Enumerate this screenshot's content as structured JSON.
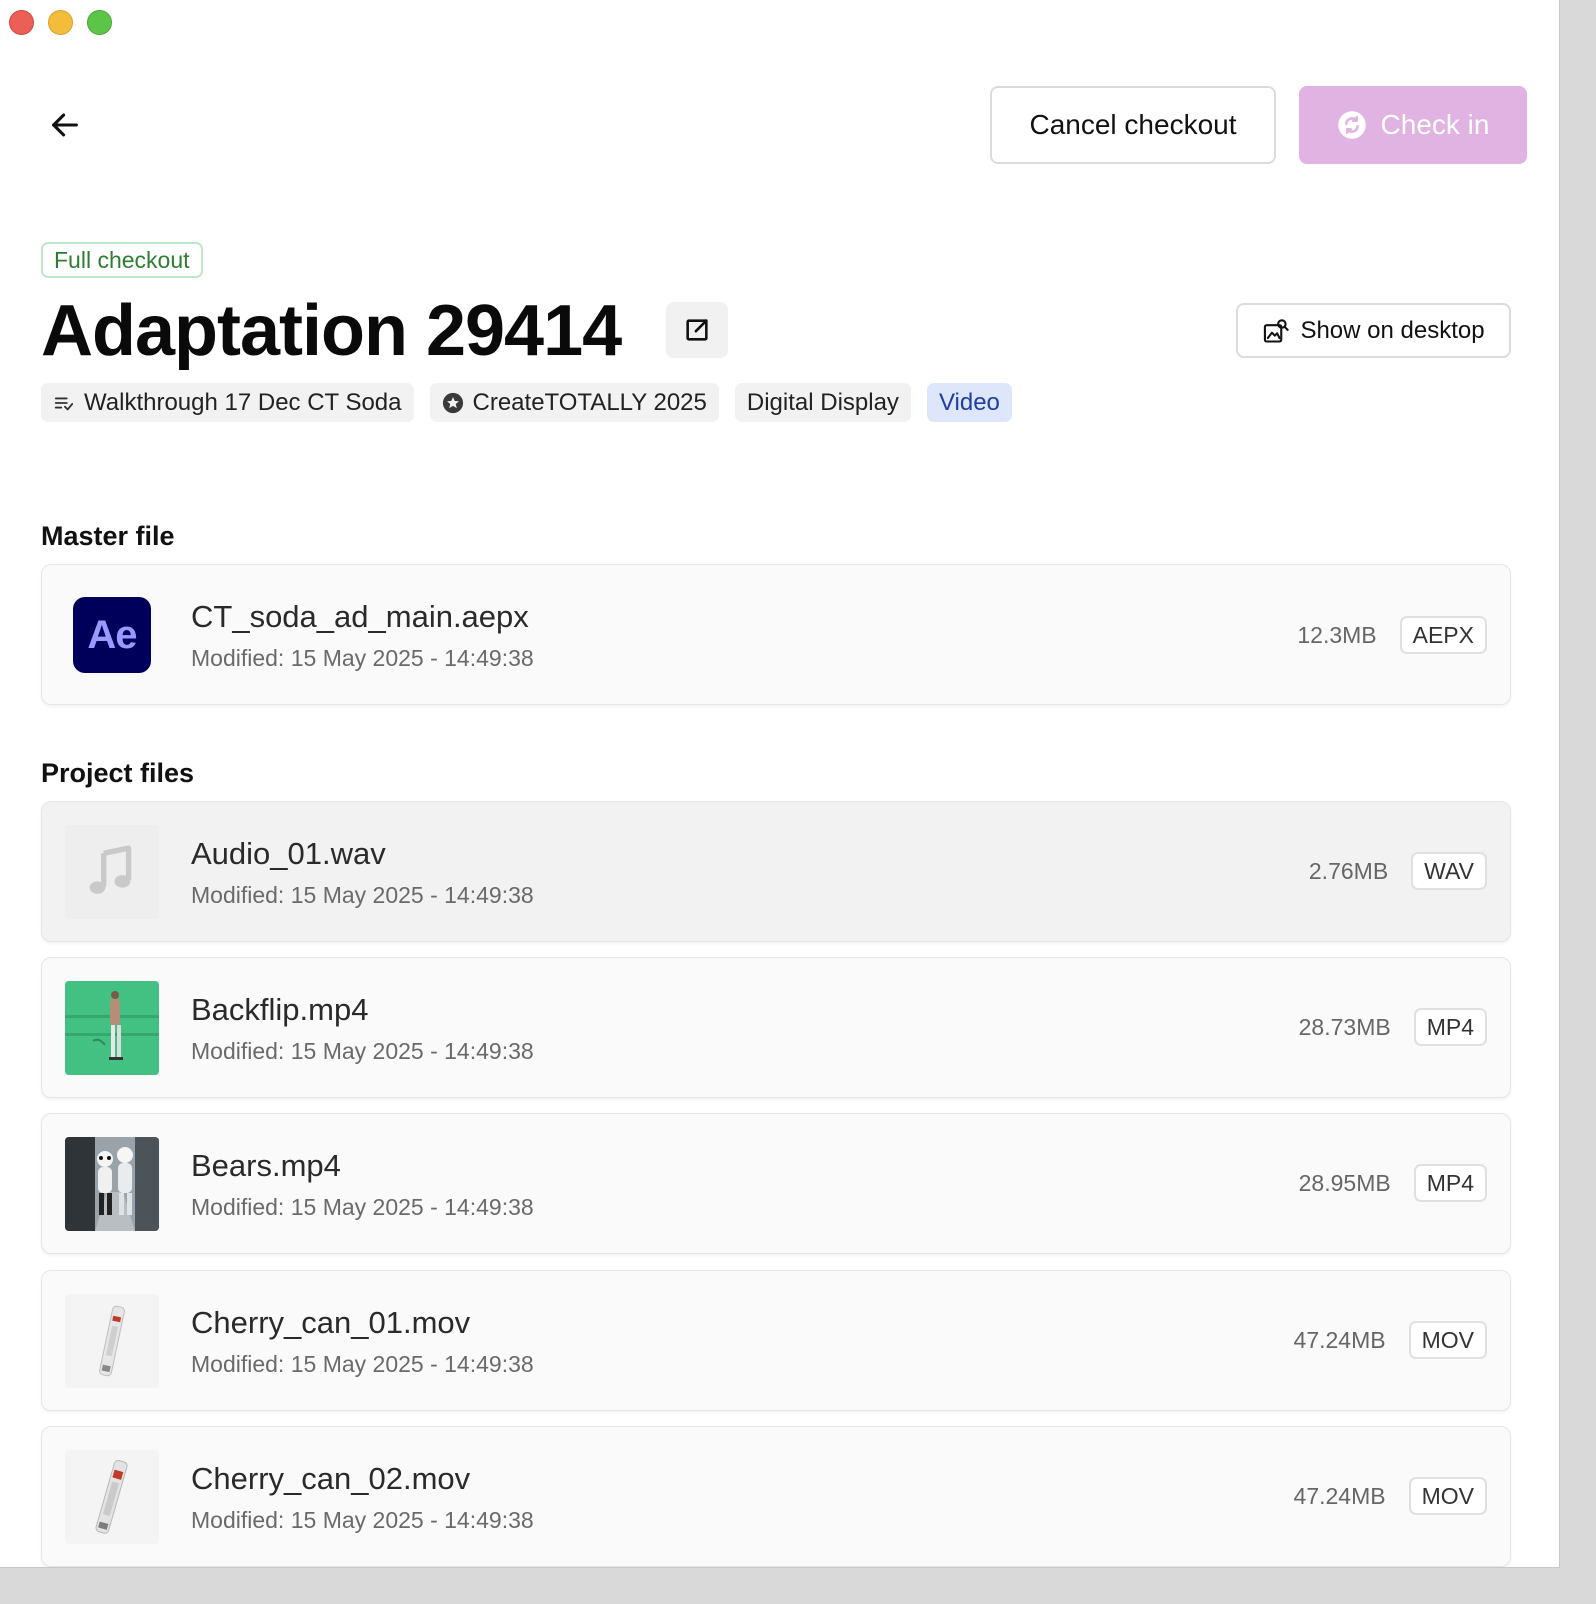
{
  "header": {
    "cancel_label": "Cancel checkout",
    "checkin_label": "Check in"
  },
  "adaptation": {
    "badge": "Full checkout",
    "title": "Adaptation 29414",
    "show_desktop_label": "Show on desktop",
    "tags": [
      {
        "label": "Walkthrough 17 Dec CT Soda",
        "icon": "list-check-icon"
      },
      {
        "label": "CreateTOTALLY 2025",
        "icon": "star-badge-icon"
      },
      {
        "label": "Digital Display",
        "icon": ""
      },
      {
        "label": "Video",
        "icon": ""
      }
    ]
  },
  "master": {
    "section_title": "Master file",
    "file": {
      "name": "CT_soda_ad_main.aepx",
      "modified": "Modified: 15 May 2025 - 14:49:38",
      "size": "12.3MB",
      "type": "AEPX",
      "icon_text": "Ae"
    }
  },
  "project": {
    "section_title": "Project files",
    "files": [
      {
        "name": "Audio_01.wav",
        "modified": "Modified: 15 May 2025 - 14:49:38",
        "size": "2.76MB",
        "type": "WAV"
      },
      {
        "name": "Backflip.mp4",
        "modified": "Modified: 15 May 2025 - 14:49:38",
        "size": "28.73MB",
        "type": "MP4"
      },
      {
        "name": "Bears.mp4",
        "modified": "Modified: 15 May 2025 - 14:49:38",
        "size": "28.95MB",
        "type": "MP4"
      },
      {
        "name": "Cherry_can_01.mov",
        "modified": "Modified: 15 May 2025 - 14:49:38",
        "size": "47.24MB",
        "type": "MOV"
      },
      {
        "name": "Cherry_can_02.mov",
        "modified": "Modified: 15 May 2025 - 14:49:38",
        "size": "47.24MB",
        "type": "MOV"
      }
    ]
  },
  "colors": {
    "accent": "#e0b3e3",
    "badge_green": "#2e7d32",
    "tag_blue_bg": "#dde6fb",
    "ae_bg": "#00005b"
  }
}
